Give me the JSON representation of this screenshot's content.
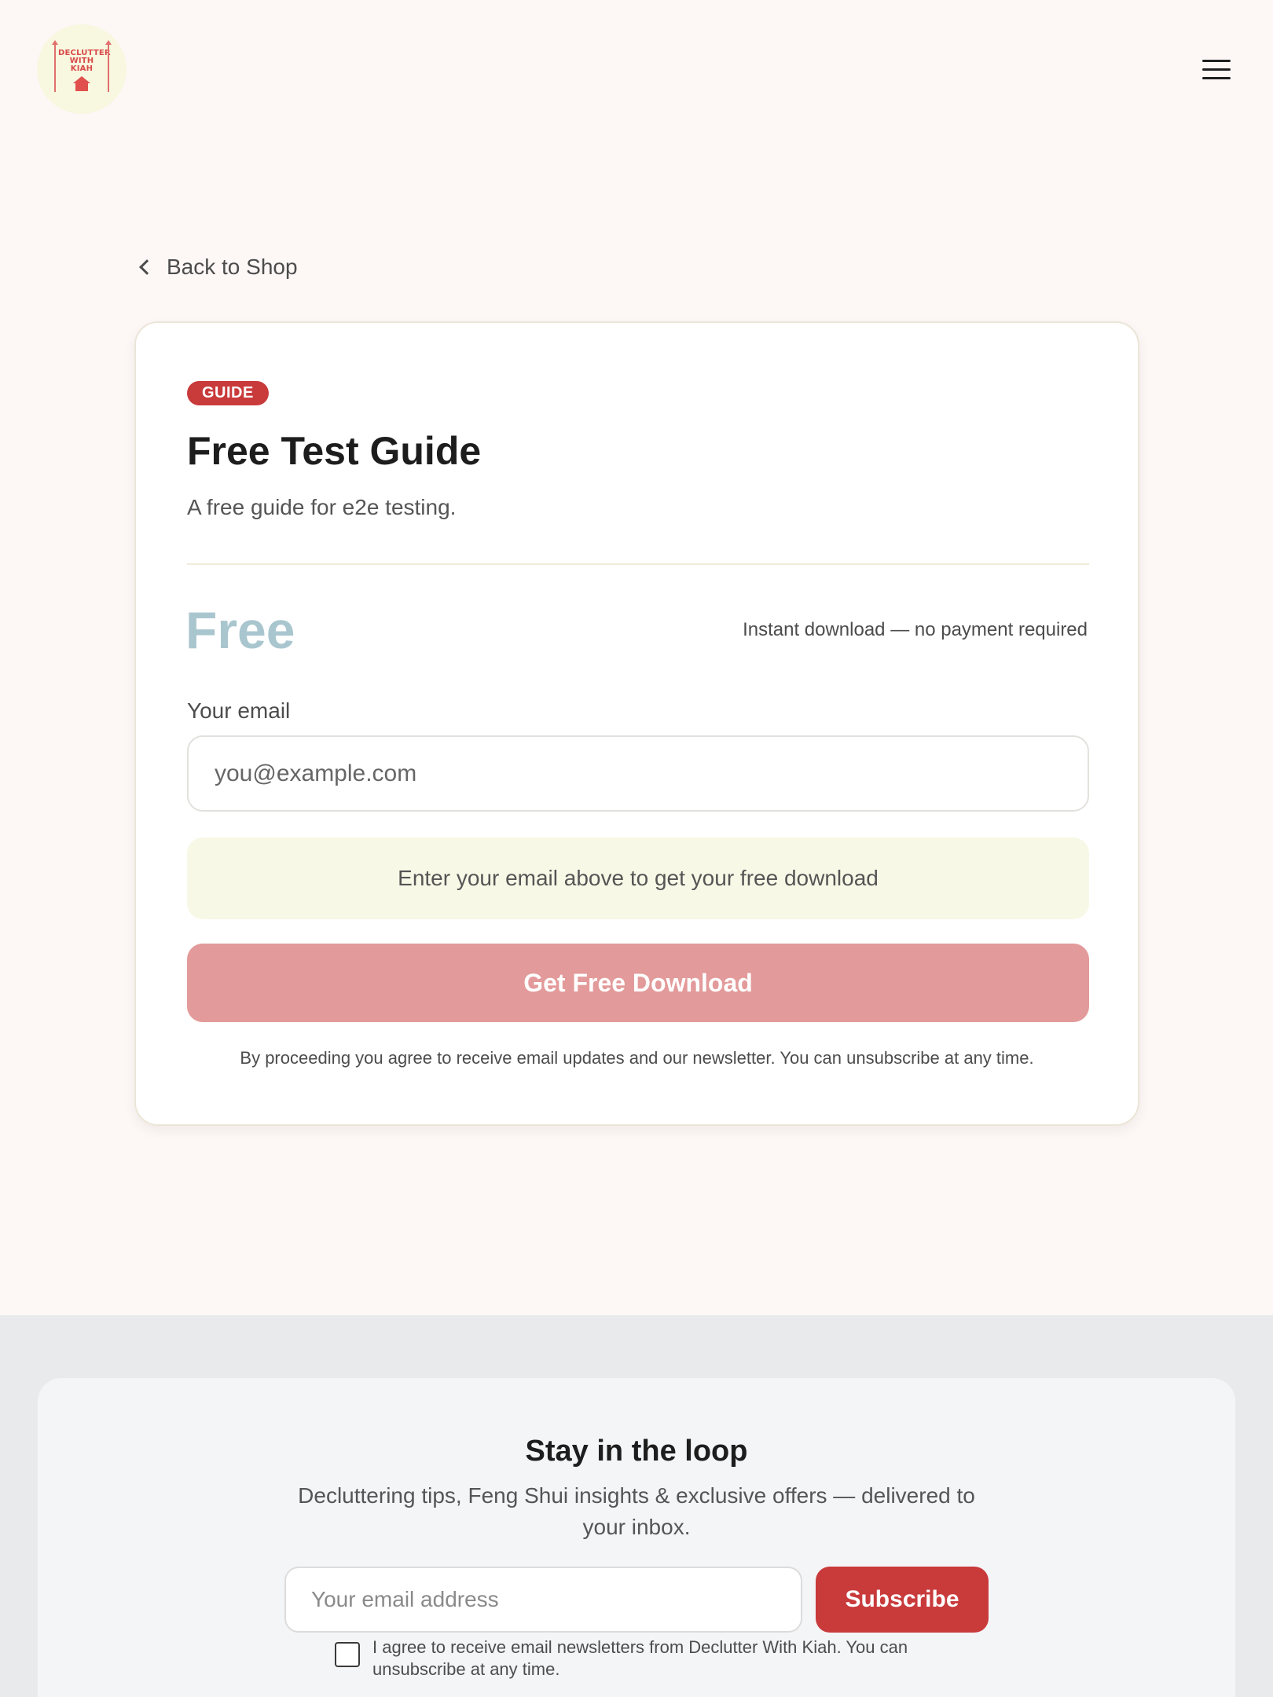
{
  "header": {
    "logo_text": "DECLUTTER WITH KIAH",
    "menu_icon": "hamburger-icon"
  },
  "nav": {
    "back_label": "Back to Shop",
    "back_icon": "chevron-left-icon"
  },
  "product": {
    "badge": "GUIDE",
    "title": "Free Test Guide",
    "description": "A free guide for e2e testing.",
    "price": "Free",
    "price_note": "Instant download — no payment required",
    "email_label": "Your email",
    "email_placeholder": "you@example.com",
    "email_value": "",
    "info_message": "Enter your email above to get your free download",
    "cta_label": "Get Free Download",
    "legal": "By proceeding you agree to receive email updates and our newsletter. You can unsubscribe at any time."
  },
  "newsletter": {
    "title": "Stay in the loop",
    "subtitle": "Decluttering tips, Feng Shui insights & exclusive offers — delivered to your inbox.",
    "email_placeholder": "Your email address",
    "button_label": "Subscribe",
    "consent": "I agree to receive email newsletters from Declutter With Kiah. You can unsubscribe at any time.",
    "consent_checked": false
  },
  "colors": {
    "background": "#fdf7f6",
    "accent": "#c93a3b",
    "cta_disabled": "#e39a9a",
    "price": "#a9c6cf",
    "info_bg": "#f8f8e7",
    "footer_bg": "#e9eaec"
  }
}
